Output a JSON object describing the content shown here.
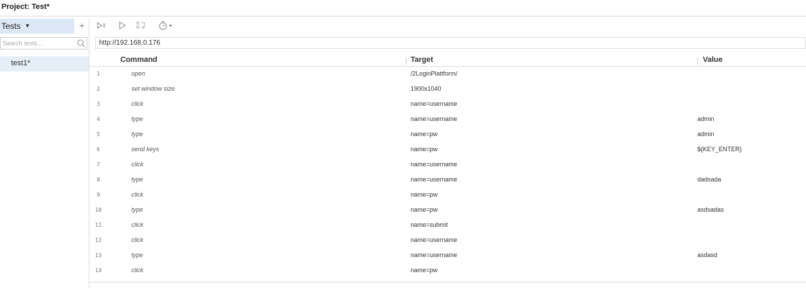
{
  "project": {
    "label": "Project:",
    "name": "Test*"
  },
  "sidebar": {
    "tests_label": "Tests",
    "add_label": "+",
    "search_placeholder": "Search tests...",
    "tests": [
      {
        "name": "test1*"
      }
    ]
  },
  "toolbar": {
    "buttons": [
      {
        "icon": "run-all-tests-icon"
      },
      {
        "icon": "run-current-test-icon"
      },
      {
        "icon": "pause-on-exceptions-icon"
      },
      {
        "icon": "test-execution-speed-icon"
      }
    ]
  },
  "url": {
    "value": "http://192.168.0.176"
  },
  "table": {
    "columns": [
      "Command",
      "Target",
      "Value"
    ],
    "rows": [
      {
        "num": "1",
        "command": "open",
        "target": "/2LoginPlattform/",
        "value": ""
      },
      {
        "num": "2",
        "command": "set window size",
        "target": "1900x1040",
        "value": ""
      },
      {
        "num": "3",
        "command": "click",
        "target": "name=username",
        "value": ""
      },
      {
        "num": "4",
        "command": "type",
        "target": "name=username",
        "value": "admin"
      },
      {
        "num": "5",
        "command": "type",
        "target": "name=pw",
        "value": "admin"
      },
      {
        "num": "6",
        "command": "send keys",
        "target": "name=pw",
        "value": "${KEY_ENTER}"
      },
      {
        "num": "7",
        "command": "click",
        "target": "name=username",
        "value": ""
      },
      {
        "num": "8",
        "command": "type",
        "target": "name=username",
        "value": "dadsada"
      },
      {
        "num": "9",
        "command": "click",
        "target": "name=pw",
        "value": ""
      },
      {
        "num": "10",
        "command": "type",
        "target": "name=pw",
        "value": "asdsadas"
      },
      {
        "num": "11",
        "command": "click",
        "target": "name=submit",
        "value": ""
      },
      {
        "num": "12",
        "command": "click",
        "target": "name=username",
        "value": ""
      },
      {
        "num": "13",
        "command": "type",
        "target": "name=username",
        "value": "asdasd"
      },
      {
        "num": "14",
        "command": "click",
        "target": "name=pw",
        "value": ""
      }
    ]
  },
  "colors": {
    "selected_bg": "#dce8f5",
    "test_item_bg": "#e6eef7",
    "border": "#dcdcdc"
  }
}
